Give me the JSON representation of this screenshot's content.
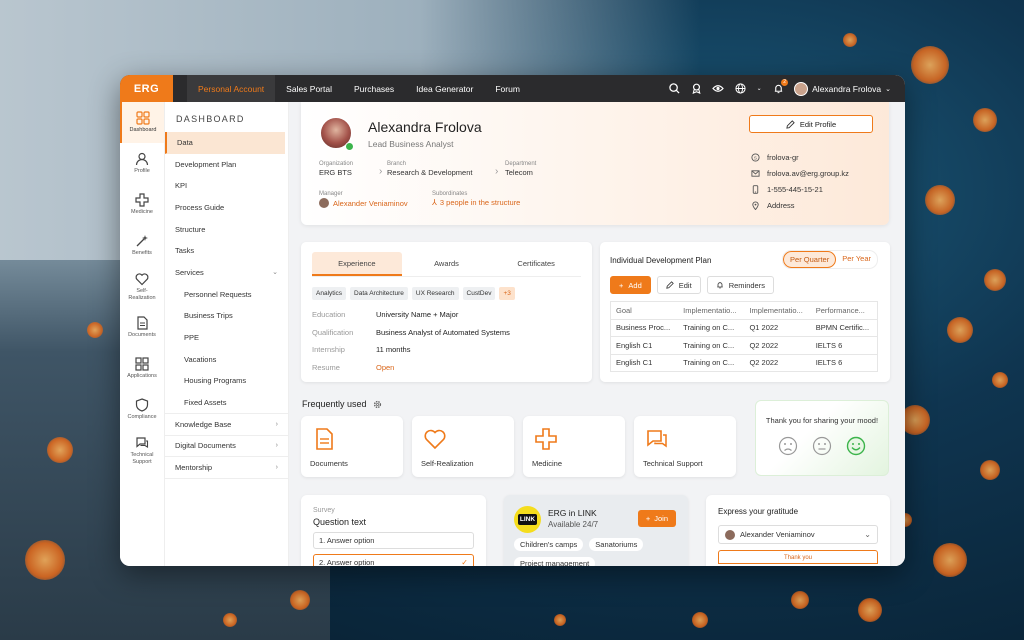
{
  "colors": {
    "accent": "#ef7a1a",
    "topbar": "#2b2b2d",
    "success": "#3cb44b"
  },
  "topbar": {
    "logo": "ERG",
    "nav": [
      "Personal Account",
      "Sales Portal",
      "Purchases",
      "Idea Generator",
      "Forum"
    ],
    "active_nav": "Personal Account",
    "notifications": "2",
    "user": "Alexandra Frolova",
    "icons": [
      "search-icon",
      "ribbon-icon",
      "eye-icon",
      "globe-icon",
      "bell-icon",
      "chevron-down-icon"
    ]
  },
  "leftbar": [
    {
      "label": "Dashboard",
      "icon": "dashboard-icon",
      "active": true
    },
    {
      "label": "Profile",
      "icon": "user-icon"
    },
    {
      "label": "Medicine",
      "icon": "medical-cross-icon"
    },
    {
      "label": "Benefits",
      "icon": "magic-wand-icon"
    },
    {
      "label": "Self-\nRealization",
      "icon": "heart-icon"
    },
    {
      "label": "Documents",
      "icon": "document-icon"
    },
    {
      "label": "Applications",
      "icon": "grid-icon"
    },
    {
      "label": "Compliance",
      "icon": "shield-icon"
    },
    {
      "label": "Technical\nSupport",
      "icon": "chat-icon"
    }
  ],
  "menu": {
    "title": "DASHBOARD",
    "items": [
      {
        "label": "Data",
        "active": true
      },
      {
        "label": "Development Plan"
      },
      {
        "label": "KPI"
      },
      {
        "label": "Process Guide"
      },
      {
        "label": "Structure"
      },
      {
        "label": "Tasks"
      },
      {
        "label": "Services",
        "expanded": true
      },
      {
        "label": "Personnel Requests",
        "sub": true
      },
      {
        "label": "Business Trips",
        "sub": true
      },
      {
        "label": "PPE",
        "sub": true
      },
      {
        "label": "Vacations",
        "sub": true
      },
      {
        "label": "Housing Programs",
        "sub": true
      },
      {
        "label": "Fixed Assets",
        "sub": true
      },
      {
        "label": "Knowledge Base",
        "chev": true
      },
      {
        "label": "Digital Documents",
        "chev": true
      },
      {
        "label": "Mentorship",
        "chev": true
      }
    ]
  },
  "profile": {
    "name": "Alexandra Frolova",
    "role": "Lead Business Analyst",
    "organization_label": "Organization",
    "organization": "ERG BTS",
    "branch_label": "Branch",
    "branch": "Research & Development",
    "department_label": "Department",
    "department": "Telecom",
    "manager_label": "Manager",
    "manager": "Alexander Veniaminov",
    "subordinates_label": "Subordinates",
    "subordinates": "3 people in the structure",
    "edit": "Edit Profile",
    "contacts": [
      {
        "icon": "skype-icon",
        "value": "frolova-gr"
      },
      {
        "icon": "mail-icon",
        "value": "frolova.av@erg.group.kz"
      },
      {
        "icon": "phone-icon",
        "value": "1-555-445-15-21"
      },
      {
        "icon": "location-icon",
        "value": "Address"
      }
    ]
  },
  "experience": {
    "tabs": [
      "Experience",
      "Awards",
      "Certificates"
    ],
    "tags": [
      "Analytics",
      "Data Architecture",
      "UX Research",
      "CustDev",
      "+3"
    ],
    "rows": [
      {
        "k": "Education",
        "v": "University Name + Major"
      },
      {
        "k": "Qualification",
        "v": "Business Analyst of Automated Systems"
      },
      {
        "k": "Internship",
        "v": "11 months"
      },
      {
        "k": "Resume",
        "v": "Open"
      }
    ]
  },
  "idp": {
    "title": "Individual Development Plan",
    "periods": [
      "Per Quarter",
      "Per Year"
    ],
    "add": "Add",
    "edit": "Edit",
    "reminders": "Reminders",
    "columns": [
      "Goal",
      "Implementatio...",
      "Implementatio...",
      "Performance..."
    ],
    "rows": [
      [
        "Business Proc...",
        "Training on C...",
        "Q1 2022",
        "BPMN Certific..."
      ],
      [
        "English C1",
        "Training on C...",
        "Q2 2022",
        "IELTS 6"
      ],
      [
        "English C1",
        "Training on C...",
        "Q2 2022",
        "IELTS 6"
      ]
    ]
  },
  "frequent": {
    "title": "Frequently used",
    "tiles": [
      {
        "label": "Documents",
        "icon": "document-icon"
      },
      {
        "label": "Self-Realization",
        "icon": "heart-icon"
      },
      {
        "label": "Medicine",
        "icon": "medical-cross-icon"
      },
      {
        "label": "Technical Support",
        "icon": "chat-icon"
      }
    ]
  },
  "mood": {
    "text": "Thank you for sharing your mood!"
  },
  "survey": {
    "kicker": "Survey",
    "question": "Question text",
    "options": [
      "1. Answer option",
      "2. Answer option"
    ]
  },
  "link": {
    "logo": "LINK",
    "title": "ERG in LINK",
    "subtitle": "Available 24/7",
    "join": "Join",
    "chips": [
      "Children's camps",
      "Sanatoriums",
      "Project management"
    ]
  },
  "gratitude": {
    "title": "Express your gratitude",
    "person": "Alexander Veniaminov",
    "button": "Thank you"
  }
}
